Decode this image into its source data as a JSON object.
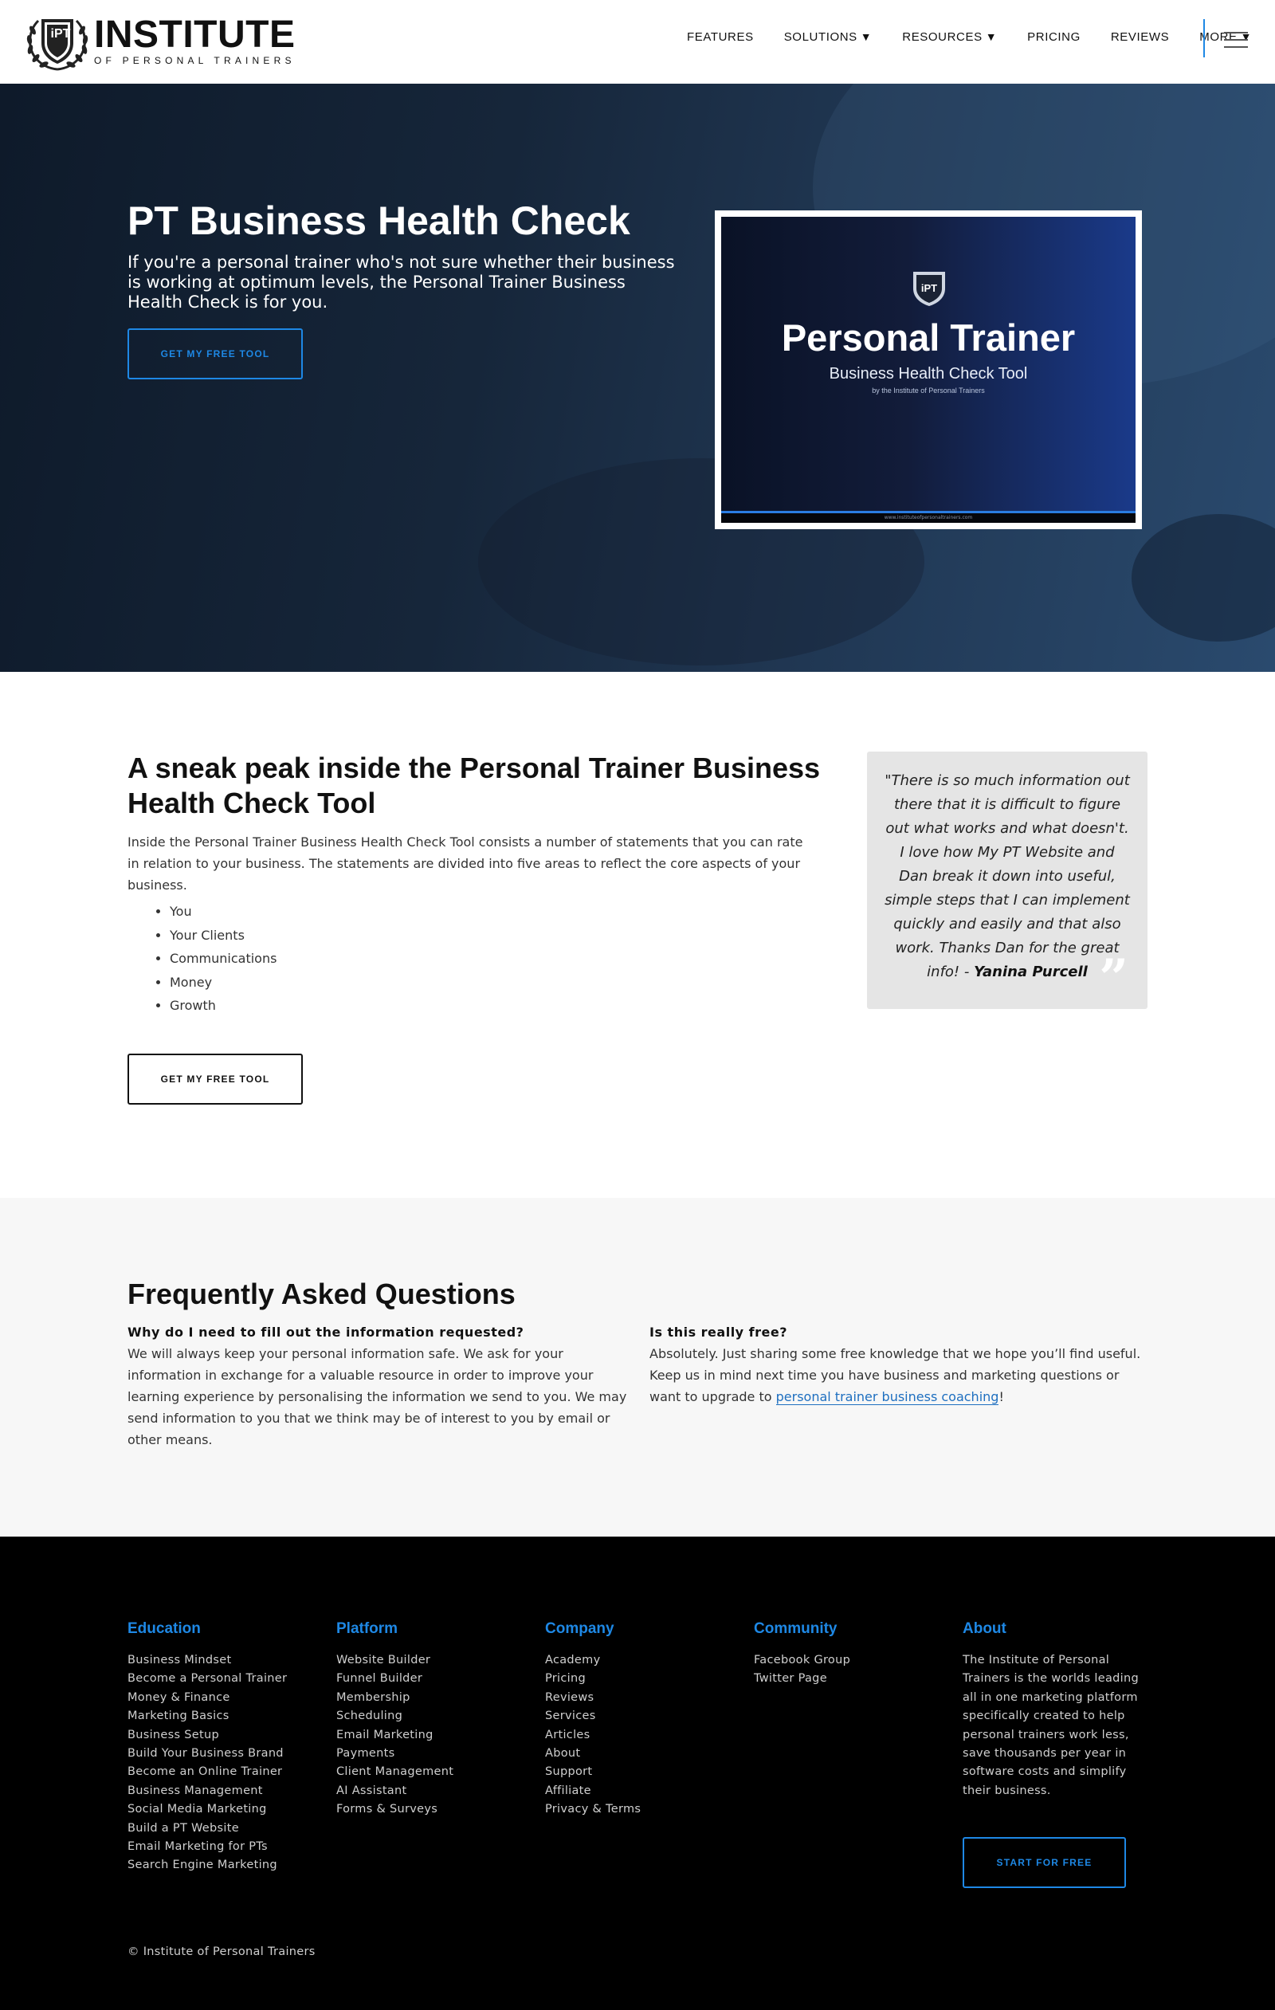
{
  "header": {
    "logo_main": "INSTITUTE",
    "logo_sub": "OF PERSONAL TRAINERS",
    "logo_badge": "iPT",
    "nav": [
      {
        "label": "FEATURES",
        "dropdown": false
      },
      {
        "label": "SOLUTIONS",
        "dropdown": true
      },
      {
        "label": "RESOURCES",
        "dropdown": true
      },
      {
        "label": "PRICING",
        "dropdown": false
      },
      {
        "label": "REVIEWS",
        "dropdown": false
      },
      {
        "label": "MORE",
        "dropdown": true
      }
    ],
    "menu_icon": "hamburger-menu-icon"
  },
  "hero": {
    "title": "PT Business Health Check",
    "subtitle": "If you're a personal trainer who's not sure whether their business is working at optimum levels, the Personal Trainer Business Health Check is for you.",
    "cta": "GET MY FREE TOOL",
    "promo": {
      "badge": "iPT",
      "title": "Personal Trainer",
      "subtitle": "Business Health Check Tool",
      "byline": "by the Institute of Personal Trainers",
      "footer_url": "www.instituteofpersonaltrainers.com"
    }
  },
  "sneak": {
    "title": "A sneak peak inside the Personal Trainer Business Health Check Tool",
    "paragraph": "Inside the Personal Trainer Business Health Check Tool consists a number of statements that you can rate in relation to your business. The statements are divided into five areas to reflect the core aspects of your business.",
    "areas": [
      "You",
      "Your Clients",
      "Communications",
      "Money",
      "Growth"
    ],
    "cta": "GET MY FREE TOOL",
    "testimonial": {
      "text": "\"There is so much information out there that it is difficult to figure out what works and what doesn't. I love how My PT Website and Dan break it down into useful, simple steps that I can implement quickly and easily and that also work. Thanks Dan for the great info! - ",
      "author": "Yanina Purcell",
      "mark": "”"
    }
  },
  "faq": {
    "title": "Frequently Asked Questions",
    "items": [
      {
        "question": "Why do I need to fill out the information requested?",
        "answer": "We will always keep your personal information safe. We ask for your information in exchange for a valuable resource in order to improve your learning experience by personalising the information we send to you. We may send information to you that we think may be of interest to you by email or other means."
      },
      {
        "question": "Is this really free?",
        "answer_before": "Absolutely. Just sharing some free knowledge that we hope you’ll find useful. Keep us in mind next time you have business and marketing questions or want to upgrade to ",
        "answer_link": "personal trainer business coaching",
        "answer_after": "!"
      }
    ]
  },
  "footer": {
    "columns": [
      {
        "heading": "Education",
        "links": [
          "Business Mindset",
          "Become a Personal Trainer",
          "Money & Finance",
          "Marketing Basics",
          "Business Setup",
          "Build Your Business Brand",
          "Become an Online Trainer",
          "Business Management",
          "Social Media Marketing",
          "Build a PT Website",
          "Email Marketing for PTs",
          "Search Engine Marketing"
        ]
      },
      {
        "heading": "Platform",
        "links": [
          "Website Builder",
          "Funnel Builder",
          "Membership",
          "Scheduling",
          "Email Marketing",
          "Payments",
          "Client Management",
          "AI Assistant",
          "Forms & Surveys"
        ]
      },
      {
        "heading": "Company",
        "links": [
          "Academy",
          "Pricing",
          "Reviews",
          "Services",
          "Articles",
          "About",
          "Support",
          "Affiliate",
          "Privacy & Terms"
        ]
      },
      {
        "heading": "Community",
        "links": [
          "Facebook Group",
          "Twitter Page"
        ]
      }
    ],
    "about": {
      "heading": "About",
      "text": "The Institute of Personal Trainers is the worlds leading all in one marketing platform specifically created to help personal trainers work less, save thousands per year in software costs and simplify their business.",
      "cta": "START FOR FREE"
    },
    "copyright": "© Institute of Personal Trainers"
  },
  "colors": {
    "accent": "#1e88e5",
    "hero_bg": "#16263a",
    "faq_bg": "#f7f7f7",
    "footer_bg": "#000000",
    "quote_bg": "#e5e5e5"
  }
}
